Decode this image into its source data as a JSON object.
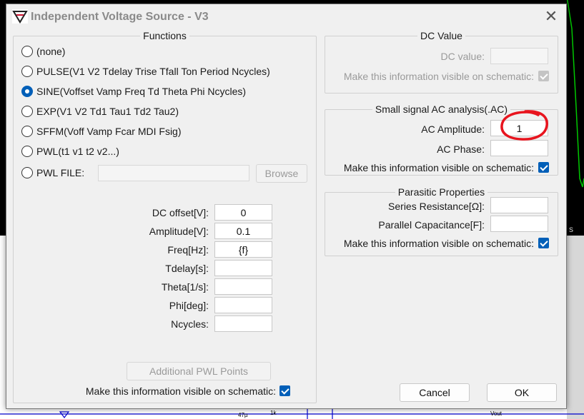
{
  "window": {
    "title": "Independent Voltage Source - V3",
    "close_glyph": "✕"
  },
  "functions": {
    "legend": "Functions",
    "options": [
      {
        "label": "(none)",
        "checked": false
      },
      {
        "label": "PULSE(V1 V2 Tdelay Trise Tfall Ton Period Ncycles)",
        "checked": false
      },
      {
        "label": "SINE(Voffset Vamp Freq Td Theta Phi Ncycles)",
        "checked": true
      },
      {
        "label": "EXP(V1 V2 Td1 Tau1 Td2 Tau2)",
        "checked": false
      },
      {
        "label": "SFFM(Voff Vamp Fcar MDI Fsig)",
        "checked": false
      },
      {
        "label": "PWL(t1 v1 t2 v2...)",
        "checked": false
      },
      {
        "label": "PWL FILE:",
        "checked": false
      }
    ],
    "pwl_file_value": "",
    "browse_label": "Browse",
    "params": [
      {
        "label": "DC offset[V]:",
        "value": "0"
      },
      {
        "label": "Amplitude[V]:",
        "value": "0.1"
      },
      {
        "label": "Freq[Hz]:",
        "value": "{f}"
      },
      {
        "label": "Tdelay[s]:",
        "value": ""
      },
      {
        "label": "Theta[1/s]:",
        "value": ""
      },
      {
        "label": "Phi[deg]:",
        "value": ""
      },
      {
        "label": "Ncycles:",
        "value": ""
      }
    ],
    "additional_pwl_label": "Additional PWL Points",
    "visible_label": "Make this information visible on schematic:",
    "visible_checked": true
  },
  "dc_value": {
    "legend": "DC Value",
    "dc_value_label": "DC value:",
    "dc_value": "",
    "visible_label": "Make this information visible on schematic:",
    "visible_checked": true,
    "disabled": true
  },
  "ac_analysis": {
    "legend": "Small signal AC analysis(.AC)",
    "amplitude_label": "AC Amplitude:",
    "amplitude_value": "1",
    "phase_label": "AC Phase:",
    "phase_value": "",
    "visible_label": "Make this information visible on schematic:",
    "visible_checked": true
  },
  "parasitic": {
    "legend": "Parasitic Properties",
    "series_resistance_label": "Series Resistance[Ω]:",
    "series_resistance_value": "",
    "parallel_capacitance_label": "Parallel Capacitance[F]:",
    "parallel_capacitance_value": "",
    "visible_label": "Make this information visible on schematic:",
    "visible_checked": true
  },
  "buttons": {
    "cancel": "Cancel",
    "ok": "OK"
  },
  "background": {
    "waveform_label_fragment": "s",
    "component_labels": [
      "47µ",
      "1k",
      "Vout"
    ]
  },
  "colors": {
    "accent": "#005fb8",
    "waveform": "#00c800",
    "annotation": "#e8141e",
    "schematic_wire": "#0000cc"
  }
}
